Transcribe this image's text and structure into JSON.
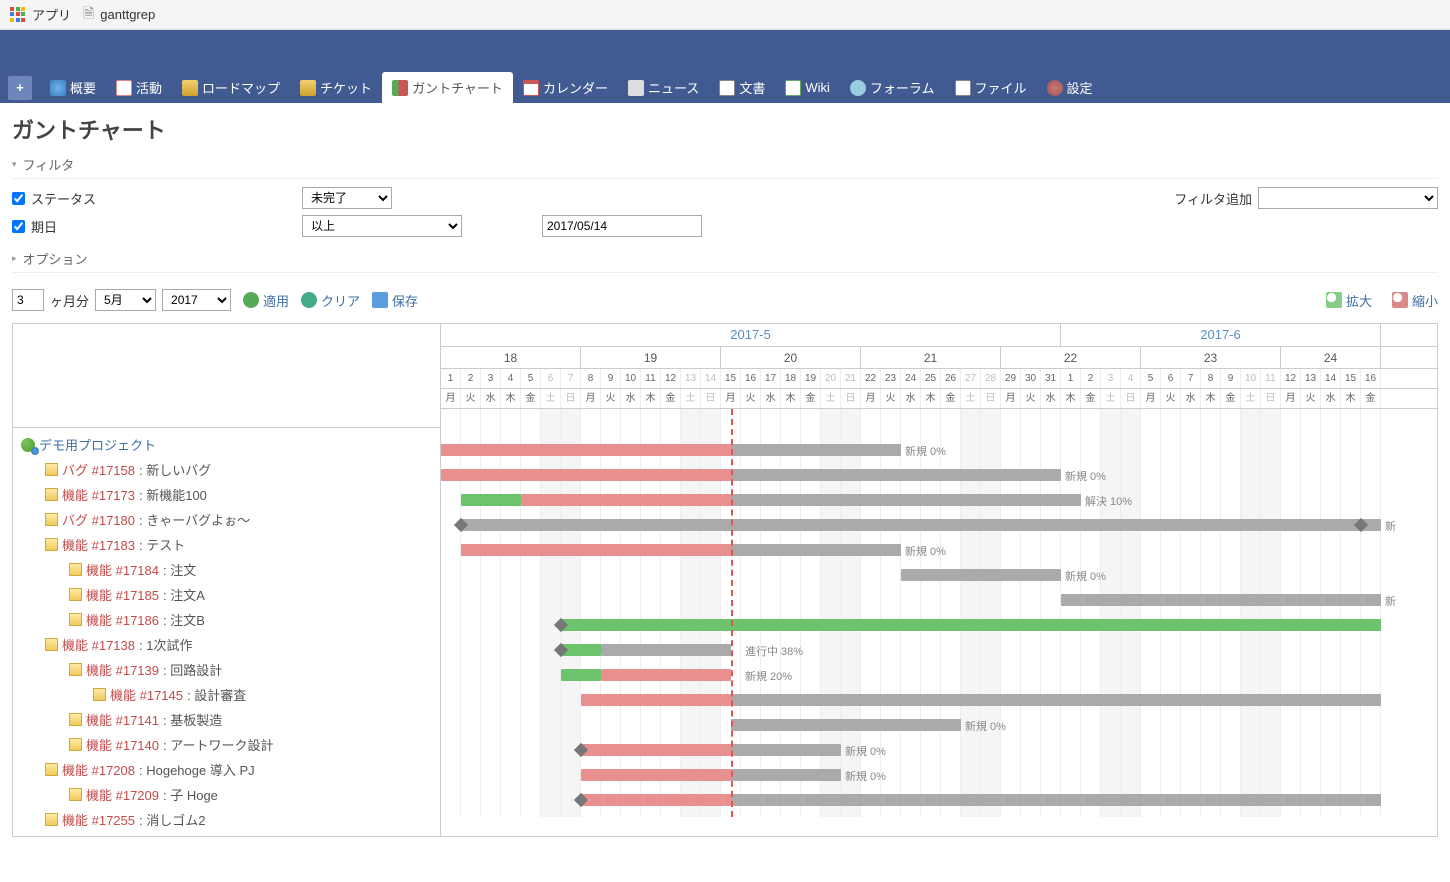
{
  "browser": {
    "apps": "アプリ",
    "tab_title": "ganttgrep"
  },
  "nav": {
    "overview": "概要",
    "activity": "活動",
    "roadmap": "ロードマップ",
    "tickets": "チケット",
    "gantt": "ガントチャート",
    "calendar": "カレンダー",
    "news": "ニュース",
    "docs": "文書",
    "wiki": "Wiki",
    "forum": "フォーラム",
    "files": "ファイル",
    "settings": "設定"
  },
  "page_title": "ガントチャート",
  "filters": {
    "heading": "フィルタ",
    "status_label": "ステータス",
    "status_value": "未完了",
    "due_label": "期日",
    "due_op": "以上",
    "due_date": "2017/05/14",
    "add_label": "フィルタ追加"
  },
  "options_heading": "オプション",
  "controls": {
    "months": "3",
    "months_unit": "ヶ月分",
    "month": "5月",
    "year": "2017",
    "apply": "適用",
    "clear": "クリア",
    "save": "保存",
    "zoom_in": "拡大",
    "zoom_out": "縮小"
  },
  "timeline": {
    "day_width": 20,
    "months": [
      {
        "label": "2017-5",
        "days": 31
      },
      {
        "label": "2017-6",
        "days": 16
      }
    ],
    "weeks": [
      {
        "label": "18",
        "span": 7
      },
      {
        "label": "19",
        "span": 7
      },
      {
        "label": "20",
        "span": 7
      },
      {
        "label": "21",
        "span": 7
      },
      {
        "label": "22",
        "span": 7
      },
      {
        "label": "23",
        "span": 7
      },
      {
        "label": "24",
        "span": 5
      }
    ],
    "days": [
      {
        "n": "1",
        "w": "月"
      },
      {
        "n": "2",
        "w": "火"
      },
      {
        "n": "3",
        "w": "水"
      },
      {
        "n": "4",
        "w": "木"
      },
      {
        "n": "5",
        "w": "金"
      },
      {
        "n": "6",
        "w": "土",
        "we": true
      },
      {
        "n": "7",
        "w": "日",
        "we": true
      },
      {
        "n": "8",
        "w": "月"
      },
      {
        "n": "9",
        "w": "火"
      },
      {
        "n": "10",
        "w": "水"
      },
      {
        "n": "11",
        "w": "木"
      },
      {
        "n": "12",
        "w": "金"
      },
      {
        "n": "13",
        "w": "土",
        "we": true
      },
      {
        "n": "14",
        "w": "日",
        "we": true
      },
      {
        "n": "15",
        "w": "月"
      },
      {
        "n": "16",
        "w": "火"
      },
      {
        "n": "17",
        "w": "水"
      },
      {
        "n": "18",
        "w": "木"
      },
      {
        "n": "19",
        "w": "金"
      },
      {
        "n": "20",
        "w": "土",
        "we": true
      },
      {
        "n": "21",
        "w": "日",
        "we": true
      },
      {
        "n": "22",
        "w": "月"
      },
      {
        "n": "23",
        "w": "火"
      },
      {
        "n": "24",
        "w": "水"
      },
      {
        "n": "25",
        "w": "木"
      },
      {
        "n": "26",
        "w": "金"
      },
      {
        "n": "27",
        "w": "土",
        "we": true
      },
      {
        "n": "28",
        "w": "日",
        "we": true
      },
      {
        "n": "29",
        "w": "月"
      },
      {
        "n": "30",
        "w": "火"
      },
      {
        "n": "31",
        "w": "水"
      },
      {
        "n": "1",
        "w": "木"
      },
      {
        "n": "2",
        "w": "金"
      },
      {
        "n": "3",
        "w": "土",
        "we": true
      },
      {
        "n": "4",
        "w": "日",
        "we": true
      },
      {
        "n": "5",
        "w": "月"
      },
      {
        "n": "6",
        "w": "火"
      },
      {
        "n": "7",
        "w": "水"
      },
      {
        "n": "8",
        "w": "木"
      },
      {
        "n": "9",
        "w": "金"
      },
      {
        "n": "10",
        "w": "土",
        "we": true
      },
      {
        "n": "11",
        "w": "日",
        "we": true
      },
      {
        "n": "12",
        "w": "月"
      },
      {
        "n": "13",
        "w": "火"
      },
      {
        "n": "14",
        "w": "水"
      },
      {
        "n": "15",
        "w": "木"
      },
      {
        "n": "16",
        "w": "金"
      }
    ],
    "today_index": 14
  },
  "rows": [
    {
      "type": "project",
      "indent": 0,
      "label": "デモ用プロジェクト"
    },
    {
      "type": "ticket",
      "indent": 1,
      "tracker": "バグ",
      "id": "#17158",
      "subject": "新しいバグ",
      "bars": [
        {
          "s": 0,
          "e": 14.5,
          "c": "late"
        },
        {
          "s": 14.5,
          "e": 23,
          "c": "todo"
        }
      ],
      "status": "新規 0%",
      "status_at": 23
    },
    {
      "type": "ticket",
      "indent": 1,
      "tracker": "機能",
      "id": "#17173",
      "subject": "新機能100",
      "bars": [
        {
          "s": 0,
          "e": 14.5,
          "c": "late"
        },
        {
          "s": 14.5,
          "e": 31,
          "c": "todo"
        }
      ],
      "status": "新規 0%",
      "status_at": 31
    },
    {
      "type": "ticket",
      "indent": 1,
      "tracker": "バグ",
      "id": "#17180",
      "subject": "きゃーバグよぉ～",
      "bars": [
        {
          "s": 1,
          "e": 4,
          "c": "done"
        },
        {
          "s": 4,
          "e": 14.5,
          "c": "late"
        },
        {
          "s": 14.5,
          "e": 32,
          "c": "todo"
        }
      ],
      "status": "解決 10%",
      "status_at": 32
    },
    {
      "type": "ticket",
      "indent": 1,
      "tracker": "機能",
      "id": "#17183",
      "subject": "テスト",
      "bars": [
        {
          "s": 1,
          "e": 47,
          "c": "todo"
        }
      ],
      "marker_start": 1,
      "marker_end": 46,
      "status": "新",
      "status_at": 47
    },
    {
      "type": "ticket",
      "indent": 2,
      "tracker": "機能",
      "id": "#17184",
      "subject": "注文",
      "bars": [
        {
          "s": 1,
          "e": 14.5,
          "c": "late"
        },
        {
          "s": 14.5,
          "e": 23,
          "c": "todo"
        }
      ],
      "status": "新規 0%",
      "status_at": 23
    },
    {
      "type": "ticket",
      "indent": 2,
      "tracker": "機能",
      "id": "#17185",
      "subject": "注文A",
      "bars": [
        {
          "s": 23,
          "e": 31,
          "c": "todo"
        }
      ],
      "status": "新規 0%",
      "status_at": 31
    },
    {
      "type": "ticket",
      "indent": 2,
      "tracker": "機能",
      "id": "#17186",
      "subject": "注文B",
      "bars": [
        {
          "s": 31,
          "e": 47,
          "c": "todo"
        }
      ],
      "status": "新",
      "status_at": 47
    },
    {
      "type": "ticket",
      "indent": 1,
      "tracker": "機能",
      "id": "#17138",
      "subject": "1次試作",
      "bars": [
        {
          "s": 6,
          "e": 47,
          "c": "done"
        }
      ],
      "marker_start": 6
    },
    {
      "type": "ticket",
      "indent": 2,
      "tracker": "機能",
      "id": "#17139",
      "subject": "回路設計",
      "bars": [
        {
          "s": 6,
          "e": 8,
          "c": "done"
        },
        {
          "s": 8,
          "e": 14.5,
          "c": "todo"
        }
      ],
      "marker_start": 6,
      "status": "進行中 38%",
      "status_at": 15
    },
    {
      "type": "ticket",
      "indent": 3,
      "tracker": "機能",
      "id": "#17145",
      "subject": "設計審査",
      "bars": [
        {
          "s": 6,
          "e": 8,
          "c": "done"
        },
        {
          "s": 8,
          "e": 14.5,
          "c": "late"
        }
      ],
      "status": "新規 20%",
      "status_at": 15
    },
    {
      "type": "ticket",
      "indent": 2,
      "tracker": "機能",
      "id": "#17141",
      "subject": "基板製造",
      "bars": [
        {
          "s": 7,
          "e": 14.5,
          "c": "late"
        },
        {
          "s": 14.5,
          "e": 47,
          "c": "todo"
        }
      ]
    },
    {
      "type": "ticket",
      "indent": 2,
      "tracker": "機能",
      "id": "#17140",
      "subject": "アートワーク設計",
      "bars": [
        {
          "s": 14.5,
          "e": 26,
          "c": "todo"
        }
      ],
      "status": "新規 0%",
      "status_at": 26
    },
    {
      "type": "ticket",
      "indent": 1,
      "tracker": "機能",
      "id": "#17208",
      "subject": "Hogehoge 導入 PJ",
      "bars": [
        {
          "s": 7,
          "e": 14.5,
          "c": "late"
        },
        {
          "s": 14.5,
          "e": 20,
          "c": "todo"
        }
      ],
      "marker_start": 7,
      "status": "新規 0%",
      "status_at": 20
    },
    {
      "type": "ticket",
      "indent": 2,
      "tracker": "機能",
      "id": "#17209",
      "subject": "子 Hoge",
      "bars": [
        {
          "s": 7,
          "e": 14.5,
          "c": "late"
        },
        {
          "s": 14.5,
          "e": 20,
          "c": "todo"
        }
      ],
      "status": "新規 0%",
      "status_at": 20
    },
    {
      "type": "ticket",
      "indent": 1,
      "tracker": "機能",
      "id": "#17255",
      "subject": "消しゴム2",
      "bars": [
        {
          "s": 7,
          "e": 14.5,
          "c": "late"
        },
        {
          "s": 14.5,
          "e": 47,
          "c": "todo"
        }
      ],
      "marker_start": 7
    }
  ],
  "colors": {
    "accent": "#415b92",
    "link": "#3b6da8",
    "ticket": "#c54b4b"
  },
  "chart_data": {
    "type": "gantt",
    "title": "ガントチャート",
    "date_range": [
      "2017-05-01",
      "2017-06-16"
    ],
    "today": "2017-05-15",
    "tasks": [
      {
        "id": 17158,
        "tracker": "バグ",
        "subject": "新しいバグ",
        "start": "2017-05-01",
        "end": "2017-05-24",
        "status": "新規",
        "progress": 0
      },
      {
        "id": 17173,
        "tracker": "機能",
        "subject": "新機能100",
        "start": "2017-05-01",
        "end": "2017-06-01",
        "status": "新規",
        "progress": 0
      },
      {
        "id": 17180,
        "tracker": "バグ",
        "subject": "きゃーバグよぉ～",
        "start": "2017-05-02",
        "end": "2017-06-02",
        "status": "解決",
        "progress": 10
      },
      {
        "id": 17183,
        "tracker": "機能",
        "subject": "テスト",
        "start": "2017-05-02",
        "end": "2017-06-16",
        "status": "新規",
        "progress": 0
      },
      {
        "id": 17184,
        "tracker": "機能",
        "subject": "注文",
        "parent": 17183,
        "start": "2017-05-02",
        "end": "2017-05-24",
        "status": "新規",
        "progress": 0
      },
      {
        "id": 17185,
        "tracker": "機能",
        "subject": "注文A",
        "parent": 17183,
        "start": "2017-05-24",
        "end": "2017-06-01",
        "status": "新規",
        "progress": 0
      },
      {
        "id": 17186,
        "tracker": "機能",
        "subject": "注文B",
        "parent": 17183,
        "start": "2017-06-01",
        "end": "2017-06-16",
        "status": "新規",
        "progress": 0
      },
      {
        "id": 17138,
        "tracker": "機能",
        "subject": "1次試作",
        "start": "2017-05-07",
        "end": "2017-06-16",
        "status": "進行中",
        "progress": 100
      },
      {
        "id": 17139,
        "tracker": "機能",
        "subject": "回路設計",
        "parent": 17138,
        "start": "2017-05-07",
        "end": "2017-05-15",
        "status": "進行中",
        "progress": 38
      },
      {
        "id": 17145,
        "tracker": "機能",
        "subject": "設計審査",
        "parent": 17139,
        "start": "2017-05-07",
        "end": "2017-05-15",
        "status": "新規",
        "progress": 20
      },
      {
        "id": 17141,
        "tracker": "機能",
        "subject": "基板製造",
        "parent": 17138,
        "start": "2017-05-08",
        "end": "2017-06-16",
        "status": "新規",
        "progress": 0
      },
      {
        "id": 17140,
        "tracker": "機能",
        "subject": "アートワーク設計",
        "parent": 17138,
        "start": "2017-05-15",
        "end": "2017-05-27",
        "status": "新規",
        "progress": 0
      },
      {
        "id": 17208,
        "tracker": "機能",
        "subject": "Hogehoge 導入 PJ",
        "start": "2017-05-08",
        "end": "2017-05-21",
        "status": "新規",
        "progress": 0
      },
      {
        "id": 17209,
        "tracker": "機能",
        "subject": "子 Hoge",
        "parent": 17208,
        "start": "2017-05-08",
        "end": "2017-05-21",
        "status": "新規",
        "progress": 0
      },
      {
        "id": 17255,
        "tracker": "機能",
        "subject": "消しゴム2",
        "start": "2017-05-08",
        "end": "2017-06-16",
        "status": "新規",
        "progress": 0
      }
    ]
  }
}
